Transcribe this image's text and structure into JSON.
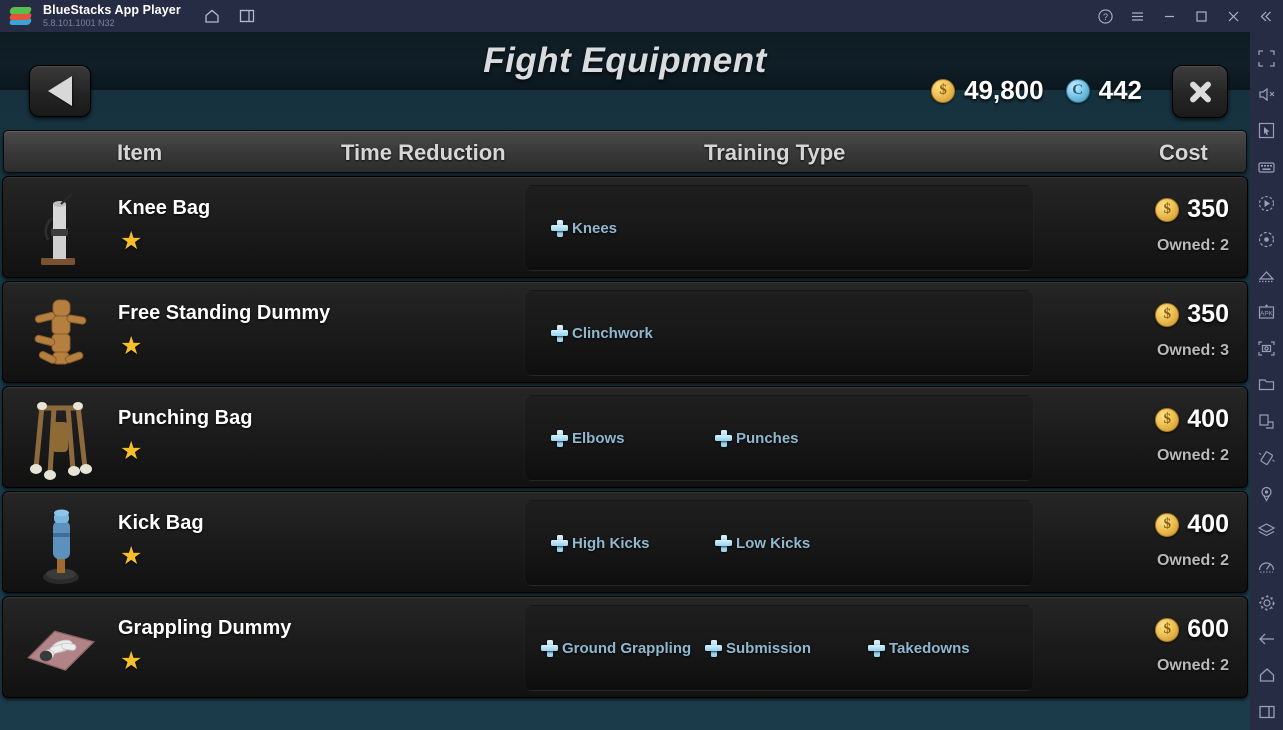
{
  "bluestacks": {
    "app_name": "BlueStacks App Player",
    "version": "5.8.101.1001  N32",
    "title_icons": [
      "home-icon",
      "multi-instance-icon"
    ],
    "window_buttons": [
      "help-icon",
      "menu-icon",
      "minimize-icon",
      "maximize-icon",
      "close-icon",
      "collapse-icon"
    ],
    "sidebar_icons": [
      "fullscreen-icon",
      "mute-icon",
      "pointer-icon",
      "keyboard-controls-icon",
      "record-macro-icon",
      "screen-record-icon",
      "multi-instance-manager-icon",
      "install-apk-icon",
      "screenshot-icon",
      "media-folder-icon",
      "rotate-window-icon",
      "shake-icon",
      "location-icon",
      "layers-icon",
      "performance-icon",
      "settings-icon",
      "back-icon",
      "home-icon",
      "recents-icon"
    ],
    "accent_bg": "#272c45"
  },
  "game": {
    "title": "Fight Equipment",
    "back_button": "back-arrow",
    "close_button": "close-x",
    "currencies": [
      {
        "name": "coins",
        "icon": "gold-coin-icon",
        "glyph": "$",
        "value": "49,800"
      },
      {
        "name": "gems",
        "icon": "blue-token-icon",
        "glyph": "C",
        "value": "442"
      }
    ],
    "columns": {
      "item": "Item",
      "time_reduction": "Time Reduction",
      "training_type": "Training Type",
      "cost": "Cost"
    },
    "rows": [
      {
        "name": "Knee Bag",
        "stars": "★",
        "thumb": "knee-bag-thumb",
        "time_reduction": "",
        "training_types": [
          "Knees"
        ],
        "cost": "350",
        "owned": "Owned: 2"
      },
      {
        "name": "Free Standing Dummy",
        "stars": "★",
        "thumb": "free-standing-dummy-thumb",
        "time_reduction": "",
        "training_types": [
          "Clinchwork"
        ],
        "cost": "350",
        "owned": "Owned: 3"
      },
      {
        "name": "Punching Bag",
        "stars": "★",
        "thumb": "punching-bag-thumb",
        "time_reduction": "",
        "training_types": [
          "Elbows",
          "Punches"
        ],
        "cost": "400",
        "owned": "Owned: 2"
      },
      {
        "name": "Kick Bag",
        "stars": "★",
        "thumb": "kick-bag-thumb",
        "time_reduction": "",
        "training_types": [
          "High Kicks",
          "Low Kicks"
        ],
        "cost": "400",
        "owned": "Owned: 2"
      },
      {
        "name": "Grappling Dummy",
        "stars": "★",
        "thumb": "grappling-dummy-thumb",
        "time_reduction": "",
        "training_types": [
          "Ground Grappling",
          "Submission",
          "Takedowns"
        ],
        "cost": "600",
        "owned": "Owned: 2"
      }
    ],
    "colors": {
      "background": "#1b3947",
      "row_bg": "#1c1c1c",
      "header_bg": "#3a3a3a",
      "star": "#f6bf2a",
      "training_text": "#8fb8cf",
      "cost_text": "#ffffff"
    }
  }
}
